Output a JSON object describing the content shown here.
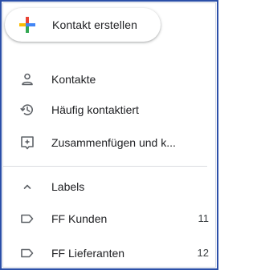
{
  "create_contact": {
    "label": "Kontakt erstellen",
    "icon": "colored-plus-icon",
    "colors": [
      "#4285F4",
      "#EA4335",
      "#FBBC04",
      "#34A853"
    ]
  },
  "nav": {
    "items": [
      {
        "label": "Kontakte",
        "icon": "person-icon"
      },
      {
        "label": "Häufig kontaktiert",
        "icon": "history-icon"
      },
      {
        "label": "Zusammenfügen und k...",
        "icon": "merge-sparkle-icon"
      }
    ]
  },
  "labels_section": {
    "header": "Labels",
    "toggle_icon": "chevron-up-icon",
    "items": [
      {
        "label": "FF Kunden",
        "count": "11",
        "icon": "label-icon"
      },
      {
        "label": "FF Lieferanten",
        "count": "12",
        "icon": "label-icon"
      }
    ]
  }
}
